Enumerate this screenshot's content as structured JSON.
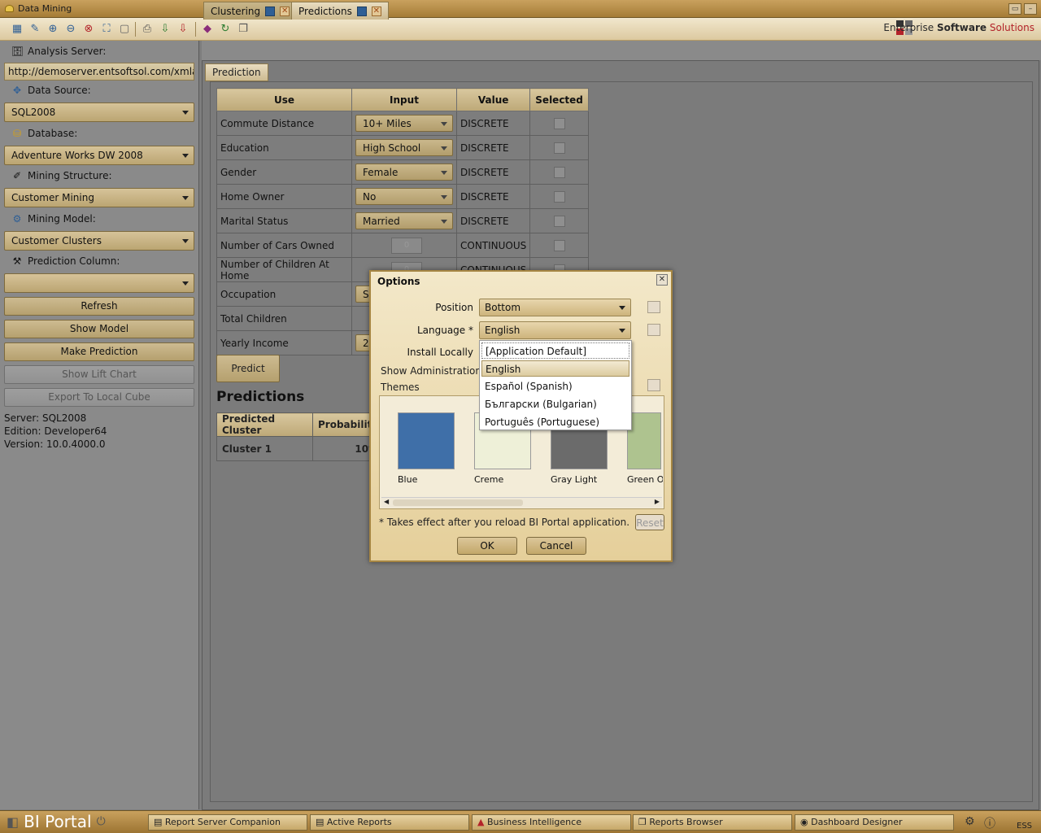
{
  "window": {
    "title": "Data Mining"
  },
  "brand": {
    "enterprise": "Enterprise ",
    "software": "Software",
    "solutions": " Solutions"
  },
  "left": {
    "analysis_server_label": "Analysis Server:",
    "analysis_server_url": "http://demoserver.entsoftsol.com/xmla/",
    "data_source_label": "Data Source:",
    "data_source_value": "SQL2008",
    "database_label": "Database:",
    "database_value": "Adventure Works DW 2008",
    "mining_structure_label": "Mining Structure:",
    "mining_structure_value": "Customer Mining",
    "mining_model_label": "Mining Model:",
    "mining_model_value": "Customer Clusters",
    "prediction_column_label": "Prediction Column:",
    "prediction_column_value": "",
    "buttons": {
      "refresh": "Refresh",
      "show_model": "Show Model",
      "make_prediction": "Make Prediction",
      "show_lift_chart": "Show Lift Chart",
      "export": "Export To Local Cube"
    },
    "info": {
      "server": "Server: SQL2008",
      "edition": "Edition: Developer64",
      "version": "Version: 10.0.4000.0"
    }
  },
  "tabs": {
    "clustering": "Clustering",
    "predictions": "Predictions",
    "prediction_sub": "Prediction"
  },
  "grid": {
    "headers": [
      "Use",
      "Input",
      "Value",
      "Selected"
    ],
    "rows": [
      {
        "use": "Commute Distance",
        "input": "10+ Miles",
        "value": "DISCRETE"
      },
      {
        "use": "Education",
        "input": "High School",
        "value": "DISCRETE"
      },
      {
        "use": "Gender",
        "input": "Female",
        "value": "DISCRETE"
      },
      {
        "use": "Home Owner",
        "input": "No",
        "value": "DISCRETE"
      },
      {
        "use": "Marital Status",
        "input": "Married",
        "value": "DISCRETE"
      },
      {
        "use": "Number of Cars Owned",
        "input": "0",
        "value": "CONTINUOUS"
      },
      {
        "use": "Number of Children At Home",
        "input": "0",
        "value": "CONTINUOUS"
      },
      {
        "use": "Occupation",
        "input": "Sl",
        "value": ""
      },
      {
        "use": "Total Children",
        "input": "",
        "value": ""
      },
      {
        "use": "Yearly Income",
        "input": "2.",
        "value": ""
      }
    ]
  },
  "predict_button": "Predict",
  "predictions": {
    "title": "Predictions",
    "headers": [
      "Predicted Cluster",
      "Probability"
    ],
    "row": {
      "cluster": "Cluster 1",
      "probability": "10%"
    }
  },
  "dialog": {
    "title": "Options",
    "position_label": "Position",
    "position_value": "Bottom",
    "language_label": "Language *",
    "language_value": "English",
    "install_locally_label": "Install Locally",
    "show_admin_label": "Show Administration",
    "themes_label": "Themes",
    "themes": [
      "Blue",
      "Creme",
      "Gray Light",
      "Green O"
    ],
    "note": "* Takes effect after you reload BI Portal application.",
    "reset": "Reset",
    "ok": "OK",
    "cancel": "Cancel",
    "language_options": [
      "[Application Default]",
      "English",
      "Español (Spanish)",
      "Български (Bulgarian)",
      "Português (Portuguese)"
    ]
  },
  "taskbar": {
    "app": "BI Portal",
    "tasks": [
      "Report Server Companion",
      "Active Reports",
      "Business Intelligence",
      "Reports Browser",
      "Dashboard Designer"
    ],
    "ess": "ESS"
  },
  "colors": {
    "accent": "#c9a15e",
    "brand_red": "#b3232a"
  }
}
